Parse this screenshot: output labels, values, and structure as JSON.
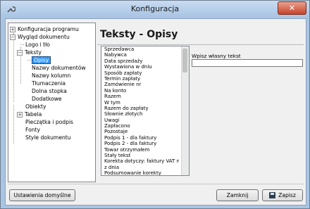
{
  "window": {
    "title": "Konfiguracja",
    "close_glyph": "✕"
  },
  "tree": {
    "items": [
      {
        "label": "Konfiguracja programu",
        "expander": "+"
      },
      {
        "label": "Wygląd dokumentu",
        "expander": "−"
      },
      {
        "label": "Logo i tło"
      },
      {
        "label": "Teksty",
        "expander": "−"
      },
      {
        "label": "Opisy",
        "selected": true
      },
      {
        "label": "Nazwy dokumentów"
      },
      {
        "label": "Nazwy kolumn"
      },
      {
        "label": "Tłumaczenia"
      },
      {
        "label": "Dolna stopka"
      },
      {
        "label": "Dodatkowe"
      },
      {
        "label": "Obiekty"
      },
      {
        "label": "Tabela",
        "expander": "+"
      },
      {
        "label": "Pieczątka i podpis"
      },
      {
        "label": "Fonty"
      },
      {
        "label": "Style dokumentu"
      }
    ]
  },
  "main": {
    "heading": "Teksty - Opisy",
    "list_items": [
      "Sprzedawca",
      "Nabywca",
      "Data sprzedaży",
      "Wystawiona w dniu",
      "Sposób zapłaty",
      "Termin zapłaty",
      "Zamówienie nr",
      "Na konto",
      "Razem",
      "W tym",
      "Razem do zapłaty",
      "Słownie złotych",
      "Uwagi",
      "Zapłacono",
      "Pozostaje",
      "Podpis 1 - dla faktury",
      "Podpis 2 - dla faktury",
      "Towar otrzymałem",
      "Stały tekst",
      "Korekta dotyczy: faktury VAT nr",
      "z dnia",
      "Podsumowanie korekty"
    ],
    "custom_text_label": "Wpisz własny tekst",
    "custom_text_value": ""
  },
  "footer": {
    "default_settings_label": "Ustawienia domyślne",
    "close_label": "Zamknij",
    "save_label": "Zapisz"
  }
}
